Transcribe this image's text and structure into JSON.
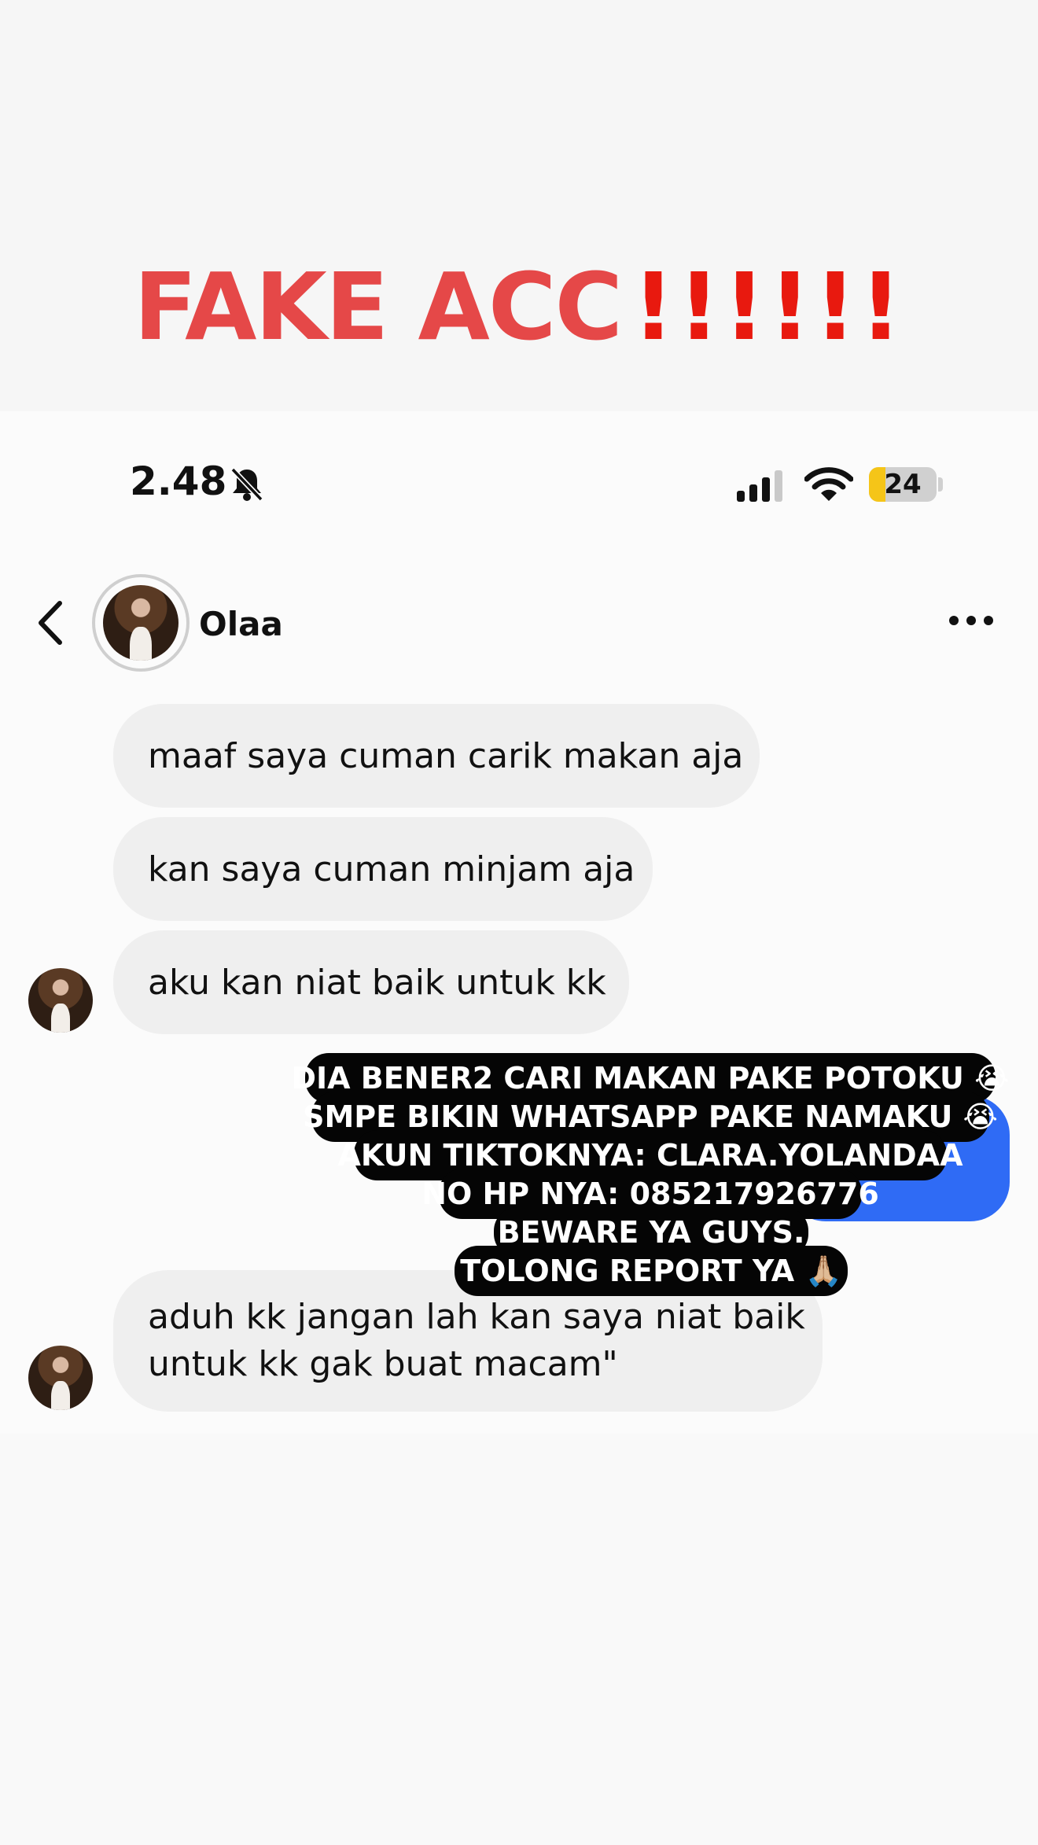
{
  "banner": {
    "title_word": "FAKE ACC",
    "title_bangs": "!!!!!!",
    "colors": {
      "word": "#e54848",
      "bangs": "#e8190f"
    }
  },
  "status_bar": {
    "time": "2.48",
    "icons": [
      "bell-slash-icon",
      "cellular-signal-icon",
      "wifi-icon",
      "battery-icon"
    ],
    "battery_level": "24",
    "battery_fraction": 0.24
  },
  "chat_header": {
    "contact_name": "Olaa",
    "icons": [
      "chevron-left-icon",
      "more-options-icon"
    ]
  },
  "messages": [
    {
      "direction": "received",
      "text": "maaf saya cuman carik makan aja"
    },
    {
      "direction": "received",
      "text": "kan saya cuman minjam aja"
    },
    {
      "direction": "received",
      "text": "aku kan niat baik untuk kk"
    },
    {
      "direction": "sent",
      "text": ""
    },
    {
      "direction": "received",
      "text": "aduh kk jangan lah kan saya niat baik\nuntuk kk gak buat macam\""
    }
  ],
  "sticker_overlay": {
    "lines": [
      "DIA BENER2 CARI MAKAN PAKE POTOKU 😭",
      "SMPE BIKIN WHATSAPP PAKE NAMAKU 😭",
      "AKUN TIKTOKNYA: CLARA.YOLANDAA",
      "NO HP NYA: 085217926776",
      "BEWARE YA GUYS.",
      "TOLONG REPORT YA 🙏🏼"
    ]
  },
  "colors": {
    "sent_bubble": "#2f6bf5",
    "received_bubble": "#efefef",
    "battery": "#f5c518"
  }
}
